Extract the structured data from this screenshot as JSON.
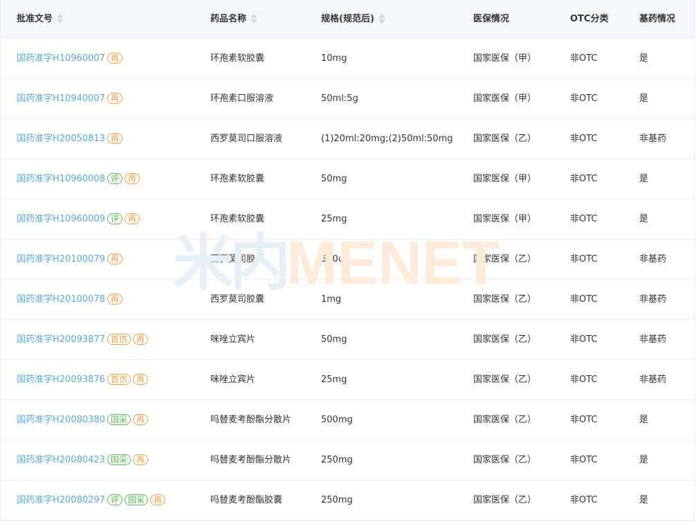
{
  "header": {
    "approval_no": "批准文号",
    "drug_name": "药品名称",
    "spec": "规格(规范后)",
    "insurance": "医保情况",
    "otc": "OTC分类",
    "essential": "基药情况"
  },
  "watermark": {
    "cn": "米内",
    "en": "MENET"
  },
  "colors": {
    "link": "#5aa9d6",
    "tag_orange": "#f0a04b",
    "tag_green": "#5fb85c",
    "header_bg": "#f4f8fc"
  },
  "rows": [
    {
      "approval_no": "国药准字H10960007",
      "tags": [
        {
          "text": "再",
          "color": "orange"
        }
      ],
      "drug_name": "环孢素软胶囊",
      "spec": "10mg",
      "insurance": "国家医保（甲）",
      "otc": "非OTC",
      "essential": "是"
    },
    {
      "approval_no": "国药准字H10940007",
      "tags": [
        {
          "text": "再",
          "color": "orange"
        }
      ],
      "drug_name": "环孢素口服溶液",
      "spec": "50ml:5g",
      "insurance": "国家医保（甲）",
      "otc": "非OTC",
      "essential": "是"
    },
    {
      "approval_no": "国药准字H20050813",
      "tags": [
        {
          "text": "再",
          "color": "orange"
        }
      ],
      "drug_name": "西罗莫司口服溶液",
      "spec": "(1)20ml:20mg;(2)50ml:50mg",
      "insurance": "国家医保（乙）",
      "otc": "非OTC",
      "essential": "非基药"
    },
    {
      "approval_no": "国药准字H10960008",
      "tags": [
        {
          "text": "评",
          "color": "green"
        },
        {
          "text": "再",
          "color": "orange"
        }
      ],
      "drug_name": "环孢素软胶囊",
      "spec": "50mg",
      "insurance": "国家医保（甲）",
      "otc": "非OTC",
      "essential": "是"
    },
    {
      "approval_no": "国药准字H10960009",
      "tags": [
        {
          "text": "评",
          "color": "green"
        },
        {
          "text": "再",
          "color": "orange"
        }
      ],
      "drug_name": "环孢素软胶囊",
      "spec": "25mg",
      "insurance": "国家医保（甲）",
      "otc": "非OTC",
      "essential": "是"
    },
    {
      "approval_no": "国药准字H20100079",
      "tags": [
        {
          "text": "再",
          "color": "orange"
        }
      ],
      "drug_name": "西罗莫司胶囊",
      "spec": "500ug",
      "insurance": "国家医保（乙）",
      "otc": "非OTC",
      "essential": "非基药"
    },
    {
      "approval_no": "国药准字H20100078",
      "tags": [
        {
          "text": "再",
          "color": "orange"
        }
      ],
      "drug_name": "西罗莫司胶囊",
      "spec": "1mg",
      "insurance": "国家医保（乙）",
      "otc": "非OTC",
      "essential": "非基药"
    },
    {
      "approval_no": "国药准字H20093877",
      "tags": [
        {
          "text": "首仿",
          "color": "orange"
        },
        {
          "text": "再",
          "color": "orange"
        }
      ],
      "drug_name": "咪唑立宾片",
      "spec": "50mg",
      "insurance": "国家医保（乙）",
      "otc": "非OTC",
      "essential": "非基药"
    },
    {
      "approval_no": "国药准字H20093876",
      "tags": [
        {
          "text": "首仿",
          "color": "orange"
        },
        {
          "text": "再",
          "color": "orange"
        }
      ],
      "drug_name": "咪唑立宾片",
      "spec": "25mg",
      "insurance": "国家医保（乙）",
      "otc": "非OTC",
      "essential": "非基药"
    },
    {
      "approval_no": "国药准字H20080380",
      "tags": [
        {
          "text": "国采",
          "color": "green"
        },
        {
          "text": "再",
          "color": "orange"
        }
      ],
      "drug_name": "吗替麦考酚酯分散片",
      "spec": "500mg",
      "insurance": "国家医保（乙）",
      "otc": "非OTC",
      "essential": "是"
    },
    {
      "approval_no": "国药准字H20080423",
      "tags": [
        {
          "text": "国采",
          "color": "green"
        },
        {
          "text": "再",
          "color": "orange"
        }
      ],
      "drug_name": "吗替麦考酚酯分散片",
      "spec": "250mg",
      "insurance": "国家医保（乙）",
      "otc": "非OTC",
      "essential": "是"
    },
    {
      "approval_no": "国药准字H20080297",
      "tags": [
        {
          "text": "评",
          "color": "green"
        },
        {
          "text": "国采",
          "color": "green"
        },
        {
          "text": "再",
          "color": "orange"
        }
      ],
      "drug_name": "吗替麦考酚酯胶囊",
      "spec": "250mg",
      "insurance": "国家医保（乙）",
      "otc": "非OTC",
      "essential": "是"
    }
  ]
}
